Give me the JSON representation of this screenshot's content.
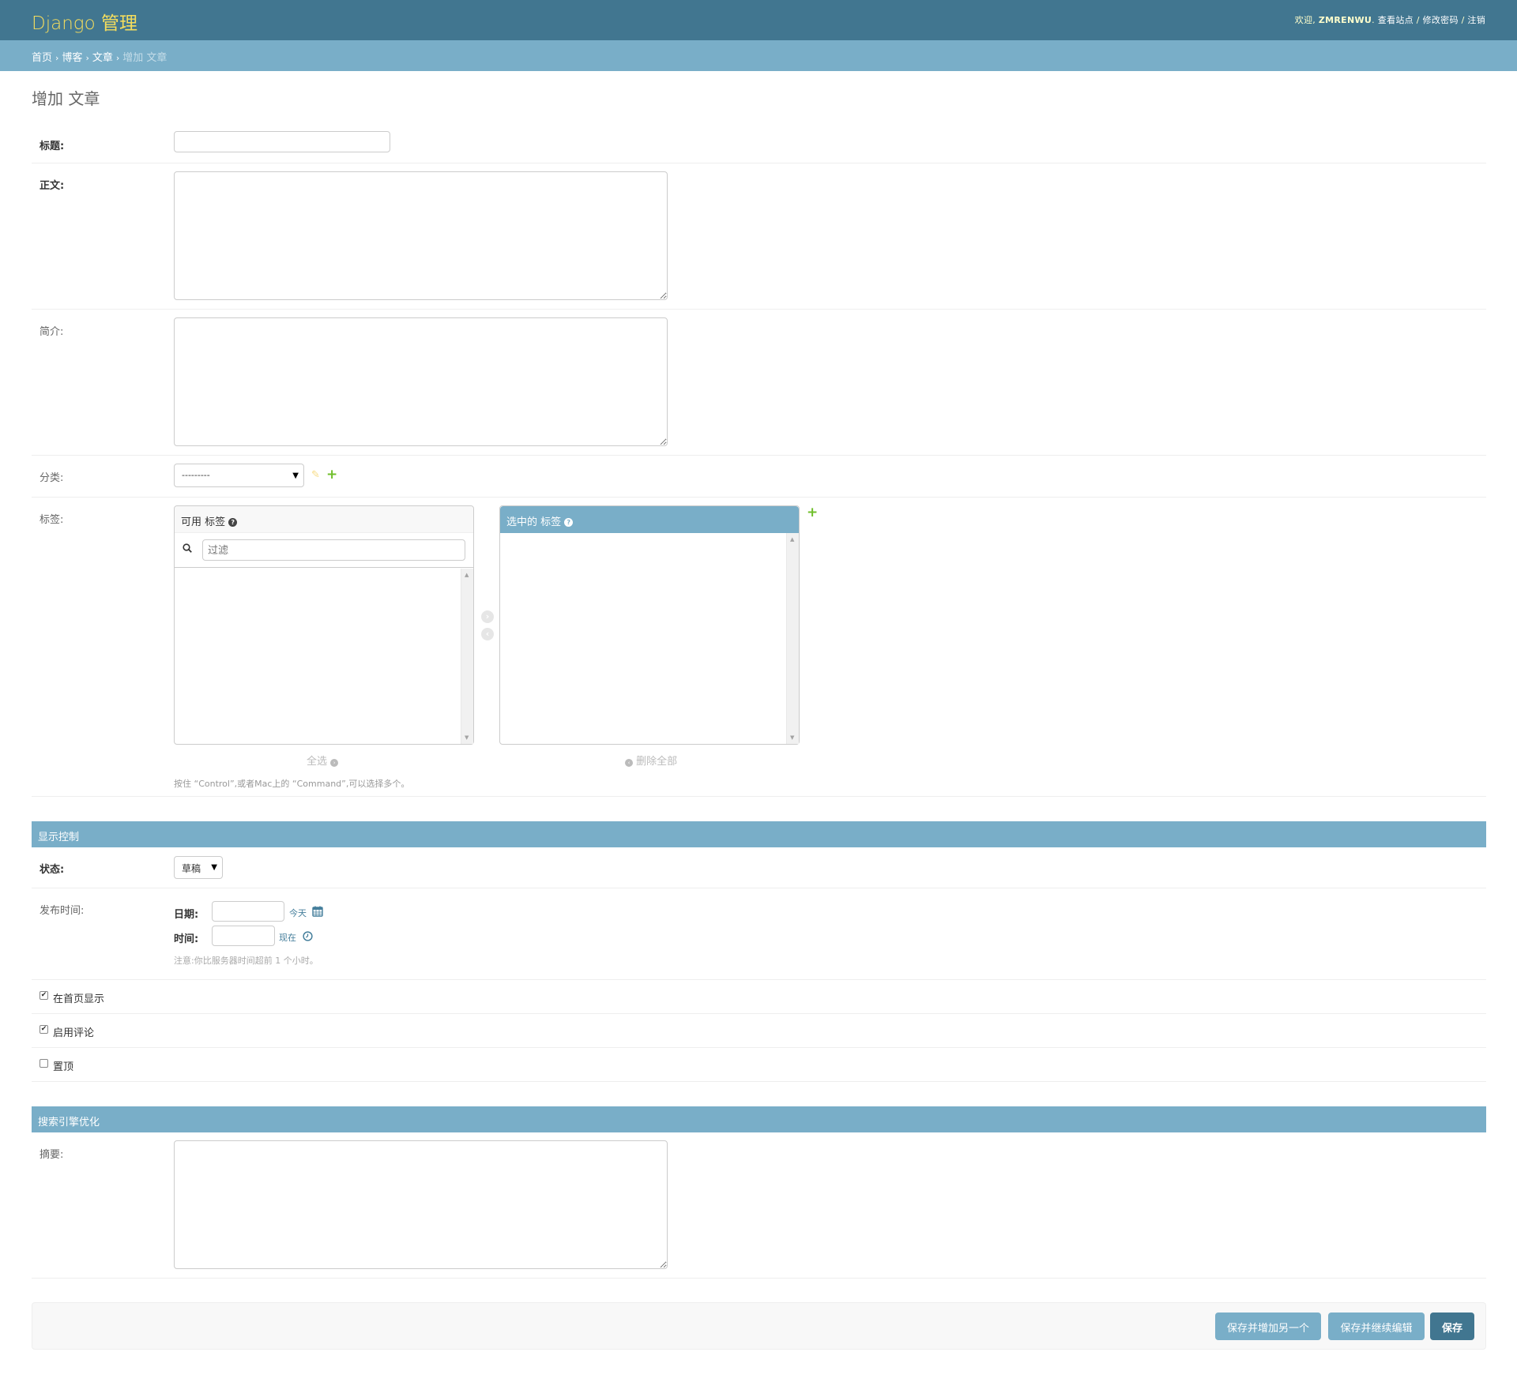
{
  "header": {
    "brand": "Django 管理",
    "welcome": "欢迎,",
    "username": "ZMRENWU",
    "links": [
      "查看站点",
      "修改密码",
      "注销"
    ],
    "separator": "/"
  },
  "breadcrumbs": [
    "首页",
    "博客",
    "文章",
    "增加 文章"
  ],
  "page_title": "增加 文章",
  "fields": {
    "title": {
      "label": "标题:",
      "value": ""
    },
    "body": {
      "label": "正文:",
      "value": ""
    },
    "excerpt": {
      "label": "简介:",
      "value": ""
    },
    "category": {
      "label": "分类:",
      "selected": "---------"
    },
    "tags": {
      "label": "标签:",
      "available_title": "可用 标签",
      "filter_placeholder": "过滤",
      "chosen_title": "选中的 标签",
      "choose_all": "全选",
      "remove_all": "删除全部",
      "help": "按住 “Control”,或者Mac上的 “Command”,可以选择多个。"
    }
  },
  "display_section": {
    "caption": "显示控制",
    "status": {
      "label": "状态:",
      "selected": "草稿"
    },
    "pub_time": {
      "label": "发布时间:",
      "date_label": "日期:",
      "date_value": "",
      "today_link": "今天",
      "time_label": "时间:",
      "time_value": "",
      "now_link": "现在",
      "note": "注意:你比服务器时间超前 1 个小时。"
    },
    "checkboxes": [
      {
        "label": "在首页显示",
        "checked": true
      },
      {
        "label": "启用评论",
        "checked": true
      },
      {
        "label": "置顶",
        "checked": false
      }
    ]
  },
  "seo_section": {
    "caption": "搜索引擎优化",
    "summary": {
      "label": "摘要:",
      "value": ""
    }
  },
  "submit": {
    "save_add_another": "保存并增加另一个",
    "save_continue": "保存并继续编辑",
    "save": "保存"
  },
  "colors": {
    "header_bg": "#417690",
    "brand": "#f5dd5d",
    "breadcrumb_bg": "#79aec8",
    "caption_bg": "#79aec8",
    "add_icon": "#70bf2b"
  }
}
